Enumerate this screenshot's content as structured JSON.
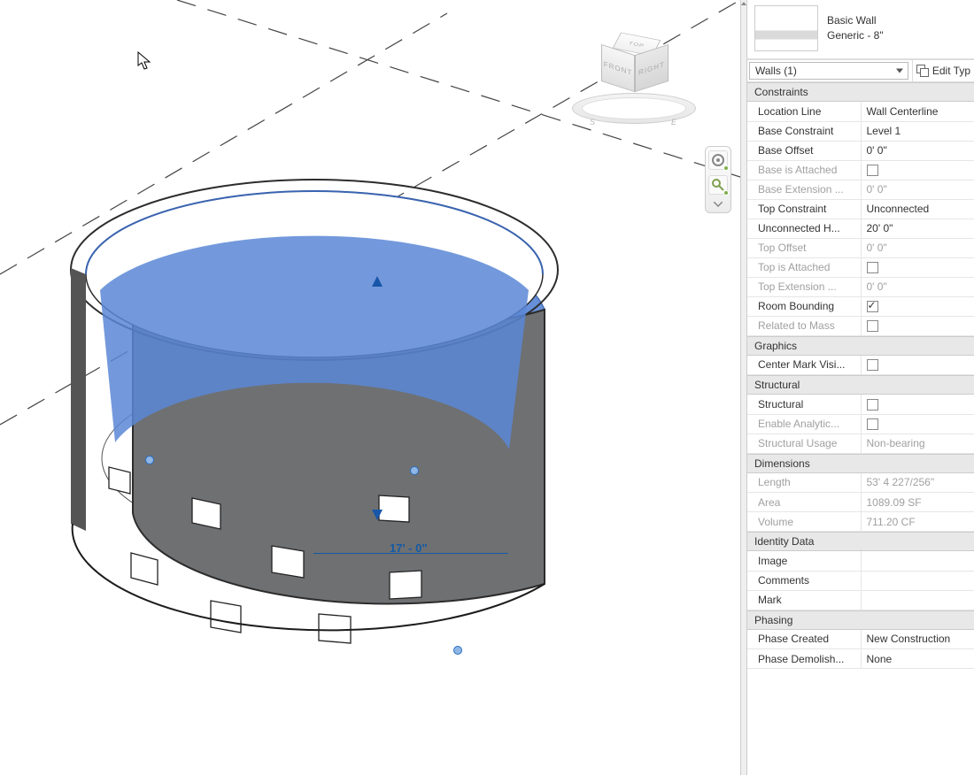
{
  "viewport": {
    "viewcube": {
      "top": "TOP",
      "front": "FRONT",
      "right": "RIGHT",
      "s": "S",
      "e": "E"
    },
    "dimension": "17' - 0\""
  },
  "panel": {
    "type_family": "Basic Wall",
    "type_name": "Generic - 8\"",
    "selector": "Walls (1)",
    "edit_type": "Edit Typ",
    "sections": {
      "constraints": "Constraints",
      "graphics": "Graphics",
      "structural": "Structural",
      "dimensions": "Dimensions",
      "identity": "Identity Data",
      "phasing": "Phasing"
    },
    "rows": {
      "location_line": {
        "label": "Location Line",
        "value": "Wall Centerline"
      },
      "base_constraint": {
        "label": "Base Constraint",
        "value": "Level 1"
      },
      "base_offset": {
        "label": "Base Offset",
        "value": "0'  0\""
      },
      "base_attached": {
        "label": "Base is Attached",
        "checked": false
      },
      "base_ext": {
        "label": "Base Extension ...",
        "value": "0'  0\""
      },
      "top_constraint": {
        "label": "Top Constraint",
        "value": "Unconnected"
      },
      "unconnected_h": {
        "label": "Unconnected H...",
        "value": "20'  0\""
      },
      "top_offset": {
        "label": "Top Offset",
        "value": "0'  0\""
      },
      "top_attached": {
        "label": "Top is Attached",
        "checked": false
      },
      "top_ext": {
        "label": "Top Extension ...",
        "value": "0'  0\""
      },
      "room_bounding": {
        "label": "Room Bounding",
        "checked": true
      },
      "related_mass": {
        "label": "Related to Mass",
        "checked": false
      },
      "center_mark": {
        "label": "Center Mark Visi...",
        "checked": false
      },
      "structural_chk": {
        "label": "Structural",
        "checked": false
      },
      "enable_analytic": {
        "label": "Enable Analytic...",
        "checked": false
      },
      "structural_usage": {
        "label": "Structural Usage",
        "value": "Non-bearing"
      },
      "length": {
        "label": "Length",
        "value": "53'  4 227/256\""
      },
      "area": {
        "label": "Area",
        "value": "1089.09 SF"
      },
      "volume": {
        "label": "Volume",
        "value": "711.20 CF"
      },
      "image": {
        "label": "Image",
        "value": ""
      },
      "comments": {
        "label": "Comments",
        "value": ""
      },
      "mark": {
        "label": "Mark",
        "value": ""
      },
      "phase_created": {
        "label": "Phase Created",
        "value": "New Construction"
      },
      "phase_demolished": {
        "label": "Phase Demolish...",
        "value": "None"
      }
    }
  }
}
